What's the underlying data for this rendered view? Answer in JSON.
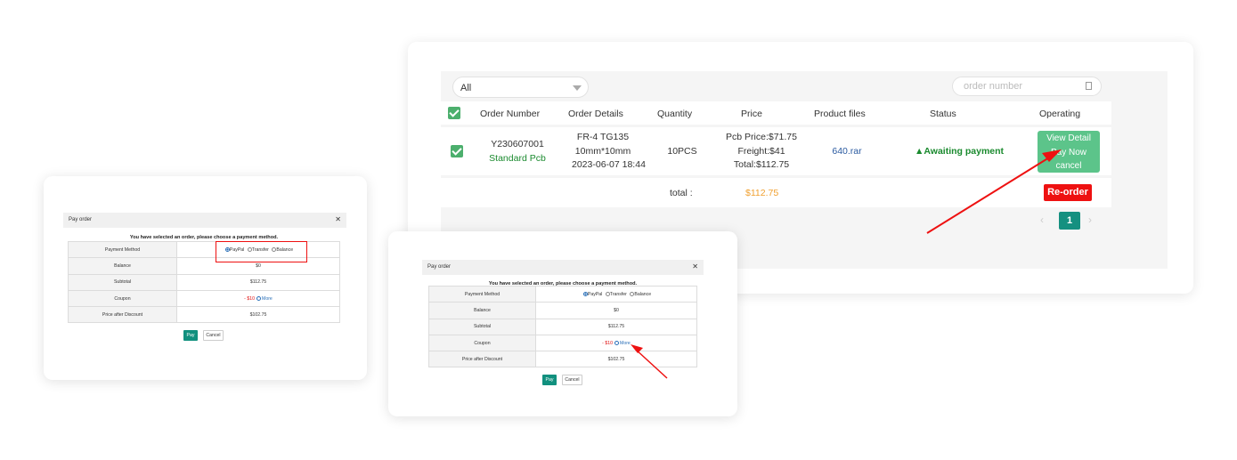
{
  "order_panel": {
    "filter_value": "All",
    "search_placeholder": "order number",
    "headers": {
      "order_number": "Order Number",
      "order_details": "Order Details",
      "quantity": "Quantity",
      "price": "Price",
      "product_files": "Product files",
      "status": "Status",
      "operating": "Operating"
    },
    "row": {
      "order_number": "Y230607001",
      "product_type": "Standard Pcb",
      "details_line1": "FR-4 TG135",
      "details_line2": "10mm*10mm",
      "details_line3": "2023-06-07 18:44",
      "quantity": "10PCS",
      "price_line1": "Pcb Price:$71.75",
      "price_line2": "Freight:$41",
      "price_line3": "Total:$112.75",
      "file": "640.rar",
      "status": "▲Awaiting payment",
      "op_view": "View Detail",
      "op_pay": "Pay Now",
      "op_cancel": "cancel"
    },
    "total_label": "total :",
    "total_value": "$112.75",
    "reorder_label": "Re-order",
    "page_current": "1",
    "colors": {
      "accent": "#159080",
      "status_green": "#1a8a2e",
      "total_orange": "#f0a030",
      "danger": "#ee1111"
    }
  },
  "pay_dialog": {
    "title": "Pay order",
    "message": "You have selected an order, please choose a payment method.",
    "rows": {
      "payment_method": "Payment Method",
      "balance": "Balance",
      "subtotal": "Subtotal",
      "coupon": "Coupon",
      "price_after_discount": "Price after Discount"
    },
    "options": {
      "paypal": "PayPal",
      "transfer": "Transfer",
      "balance": "Balance"
    },
    "balance_value": "$0",
    "subtotal_value": "$112.75",
    "coupon_value": "- $10",
    "coupon_more": "More",
    "discount_value": "$102.75",
    "pay_label": "Pay",
    "cancel_label": "Cancel"
  }
}
